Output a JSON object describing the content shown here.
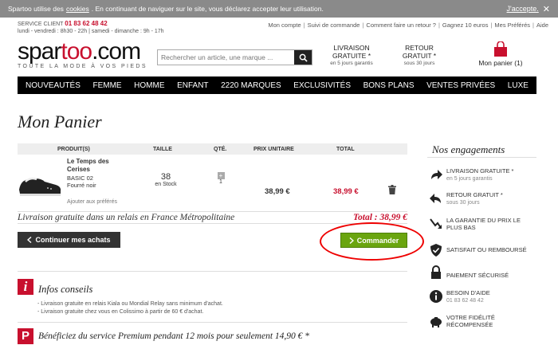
{
  "cookie": {
    "text_before": "Spartoo utilise des",
    "link": "cookies",
    "text_after": ". En continuant de naviguer sur le site, vous déclarez accepter leur utilisation.",
    "accept": "J'accepte.",
    "close": "✕"
  },
  "service": {
    "label": "SERVICE CLIENT",
    "phone": "01 83 62 48 42",
    "hours": "lundi - vendredi : 8h30 - 22h | samedi - dimanche : 9h - 17h"
  },
  "toplinks": [
    "Mon compte",
    "Suivi de commande",
    "Comment faire un retour ?",
    "Gagnez 10 euros",
    "Mes Préférés",
    "Aide"
  ],
  "logo": {
    "part1": "spar",
    "part2": "too",
    "part3": ".com",
    "tagline": "TOUTE LA MODE À VOS PIEDS"
  },
  "search": {
    "placeholder": "Rechercher un article, une marque ..."
  },
  "promos": [
    {
      "title": "LIVRAISON",
      "title2": "GRATUITE *",
      "sub": "en 5 jours garantis"
    },
    {
      "title": "RETOUR",
      "title2": "GRATUIT *",
      "sub": "sous 30 jours"
    }
  ],
  "cart": {
    "label": "Mon panier (1)"
  },
  "nav": [
    "NOUVEAUTÉS",
    "FEMME",
    "HOMME",
    "ENFANT",
    "2220 MARQUES",
    "EXCLUSIVITÉS",
    "BONS PLANS",
    "VENTES PRIVÉES",
    "LUXE"
  ],
  "page_title": "Mon Panier",
  "table": {
    "headers": [
      "PRODUIT(S)",
      "TAILLE",
      "QTÉ.",
      "PRIX UNITAIRE",
      "TOTAL"
    ],
    "item": {
      "name": "Le Temps des Cerises",
      "ref": "BASIC 02",
      "color": "Fourré noir",
      "fav": "Ajouter aux préférés",
      "size": "38",
      "stock": "en Stock",
      "qty": "1",
      "qty_plus": "+",
      "unit_price": "38,99 €",
      "total": "38,99 €"
    }
  },
  "summary": {
    "delivery": "Livraison gratuite dans un relais en France Métropolitaine",
    "total": "Total : 38,99 €"
  },
  "buttons": {
    "continue": "Continuer mes achats",
    "order": "Commander"
  },
  "infos": {
    "title": "Infos conseils",
    "lines": [
      "- Livraison gratuite en relais Kiala ou Mondial Relay sans minimum d'achat.",
      "- Livraison gratuite chez vous en Colissimo à partir de 60 € d'achat."
    ]
  },
  "premium": {
    "title": "Bénéficiez du service Premium pendant 12 mois pour seulement 14,90 € *"
  },
  "engagements": {
    "title": "Nos engagements",
    "items": [
      {
        "text": "LIVRAISON GRATUITE *",
        "sub": "en 5 jours garantis"
      },
      {
        "text": "RETOUR GRATUIT *",
        "sub": "sous 30 jours"
      },
      {
        "text": "LA GARANTIE DU PRIX LE PLUS BAS",
        "sub": ""
      },
      {
        "text": "SATISFAIT OU REMBOURSÉ",
        "sub": ""
      },
      {
        "text": "PAIEMENT SÉCURISÉ",
        "sub": ""
      },
      {
        "text": "BESOIN D'AIDE",
        "sub": "01 83 62 48 42"
      },
      {
        "text": "VOTRE FIDÉLITÉ RÉCOMPENSÉE",
        "sub": ""
      }
    ]
  },
  "colors": {
    "accent": "#c8102e",
    "order_green": "#6aa50f",
    "annotation": "#ee0000"
  }
}
